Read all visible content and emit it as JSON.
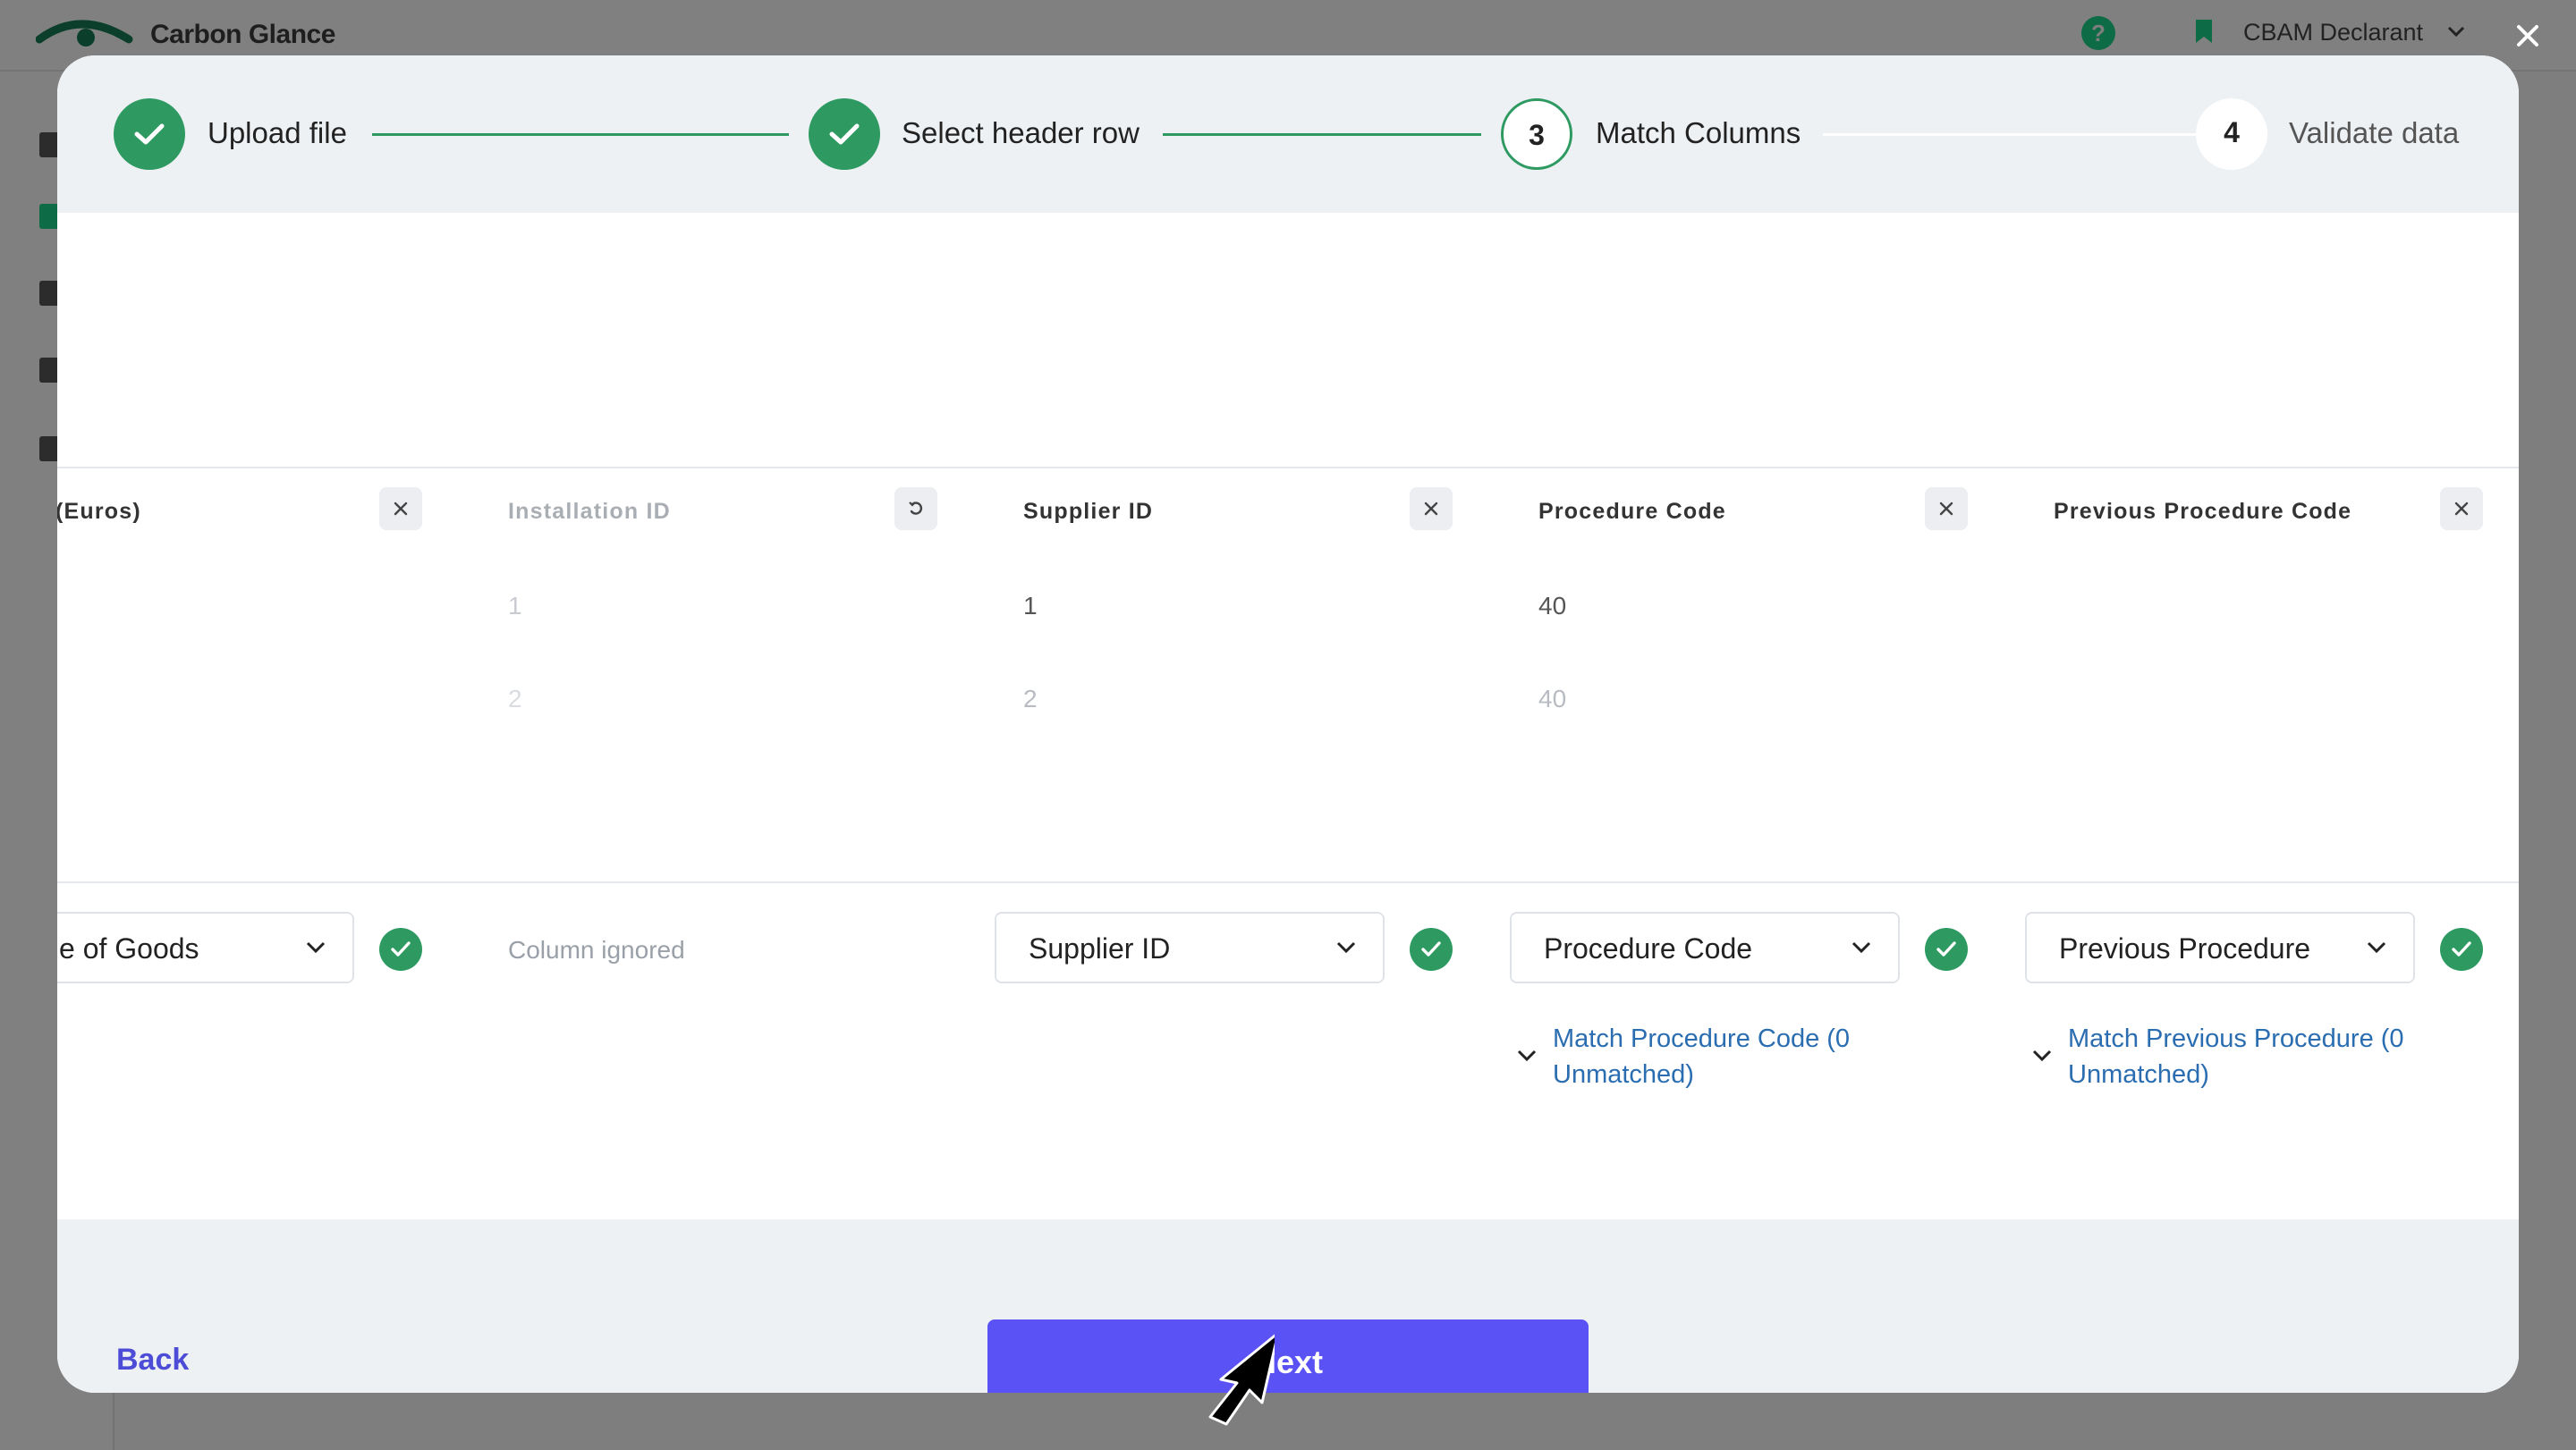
{
  "app": {
    "brand": "Carbon Glance",
    "account": "CBAM Declarant",
    "help_icon": "?"
  },
  "stepper": {
    "steps": [
      {
        "label": "Upload file",
        "state": "done"
      },
      {
        "label": "Select header row",
        "state": "done"
      },
      {
        "number": "3",
        "label": "Match Columns",
        "state": "active"
      },
      {
        "number": "4",
        "label": "Validate data",
        "state": "todo"
      }
    ]
  },
  "columns": [
    {
      "header": "(Euros)",
      "action": "ignore",
      "rows": [],
      "match_value": "e of Goods",
      "matched": true
    },
    {
      "header": "Installation ID",
      "action": "restore",
      "rows": [
        "1",
        "2"
      ],
      "ignored_label": "Column ignored"
    },
    {
      "header": "Supplier ID",
      "action": "ignore",
      "rows": [
        "1",
        "2"
      ],
      "match_value": "Supplier ID",
      "matched": true
    },
    {
      "header": "Procedure Code",
      "action": "ignore",
      "rows": [
        "40",
        "40"
      ],
      "match_value": "Procedure Code",
      "matched": true,
      "link": "Match Procedure Code (0 Unmatched)"
    },
    {
      "header": "Previous Procedure Code",
      "action": "ignore",
      "rows": [],
      "match_value": "Previous Procedure",
      "matched": true,
      "link": "Match Previous Procedure (0 Unmatched)"
    }
  ],
  "footer": {
    "back_label": "Back",
    "next_label": "Next"
  },
  "colors": {
    "accent_green": "#2e9a62",
    "primary_button": "#5b52f5",
    "link_blue": "#2a6db0"
  }
}
